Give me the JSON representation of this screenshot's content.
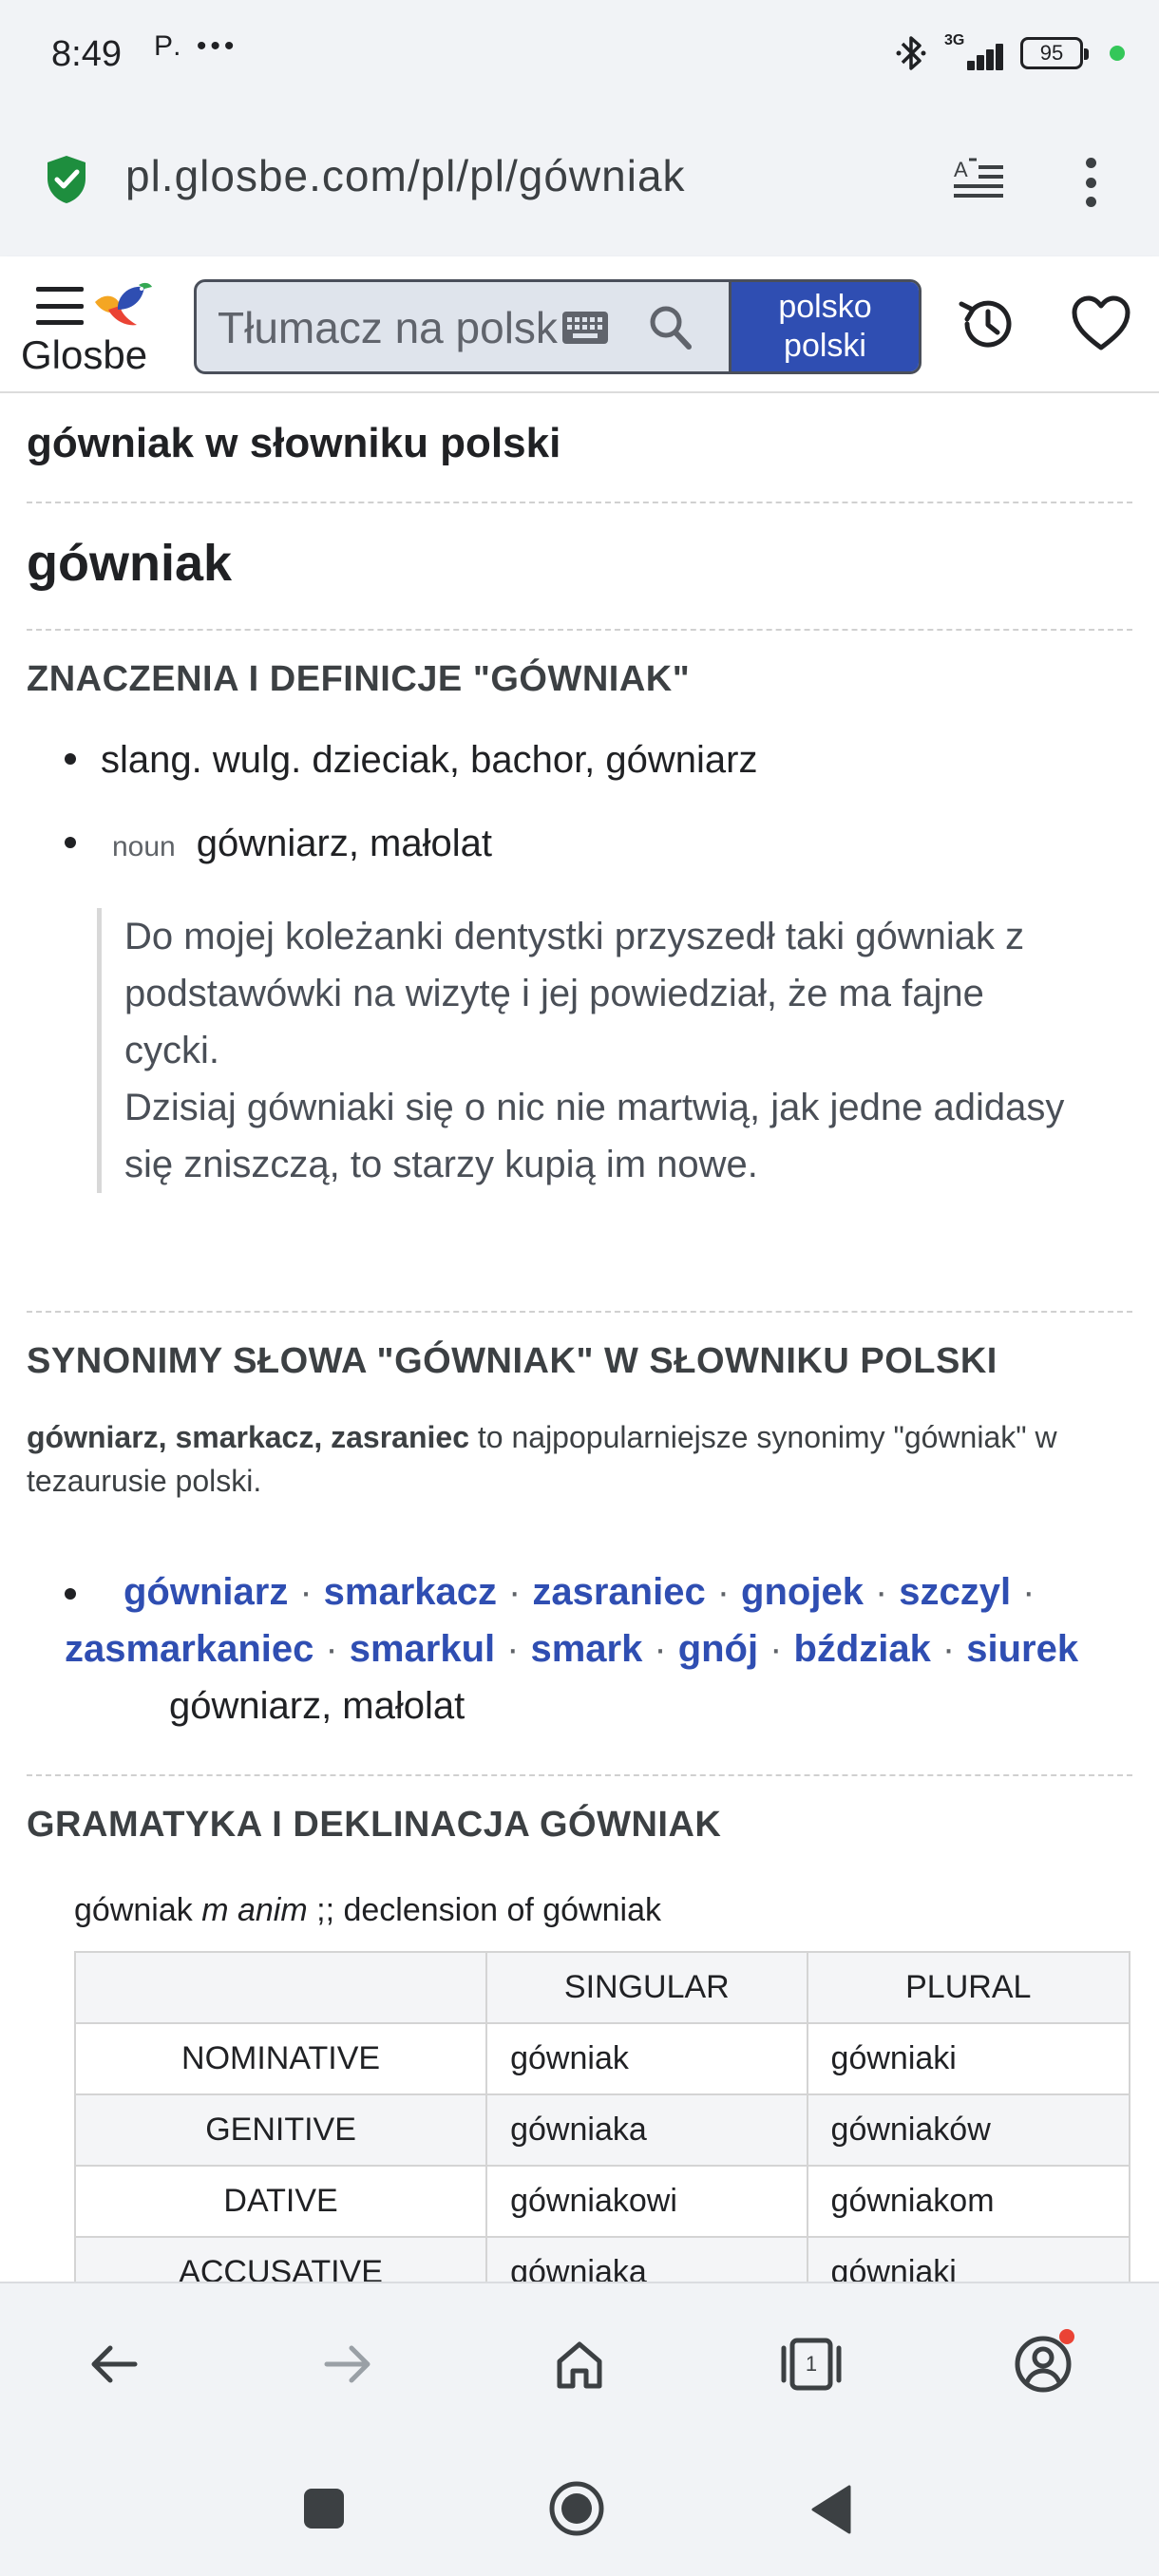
{
  "status_bar": {
    "time": "8:49",
    "extra": "P. •••",
    "network": "3G",
    "battery": "95"
  },
  "browser": {
    "url": "pl.glosbe.com/pl/pl/gówniak",
    "icons": [
      "shield-check-icon",
      "reader-mode-icon",
      "more-vert-icon"
    ]
  },
  "header": {
    "logo": "Glosbe",
    "search_placeholder": "Tłumacz na polski",
    "lang_line1": "polsko",
    "lang_line2": "polski",
    "icons": [
      "menu-icon",
      "glosbe-bird-icon",
      "keyboard-icon",
      "search-icon",
      "history-icon",
      "heart-icon"
    ]
  },
  "page": {
    "dictionary_title": "gówniak w słowniku polski",
    "headword": "gówniak",
    "meanings_heading": "ZNACZENIA I DEFINICJE \"GÓWNIAK\"",
    "meanings": [
      {
        "pos": "",
        "text": "slang. wulg. dzieciak, bachor, gówniarz"
      },
      {
        "pos": "noun",
        "text": "gówniarz, małolat"
      }
    ],
    "example_lines": [
      "Do mojej koleżanki dentystki przyszedł taki gówniak z",
      "podstawówki na wizytę i jej powiedział, że ma fajne",
      "cycki.",
      "Dzisiaj gówniaki się o nic nie martwią, jak jedne adidasy",
      "się zniszczą, to starzy kupią im nowe."
    ],
    "synonyms_heading": {
      "p1": "SYNONIMY ",
      "b1": "SŁOWA",
      "p2": " \"",
      "b2": "GÓWNIAK",
      "p3": "\" W SŁOWNIKU POLSKI"
    },
    "synonyms_desc": {
      "bold": "gówniarz, smarkacz, zasraniec",
      "rest": " to najpopularniejsze synonimy \"gówniak\" w tezaurusie polski."
    },
    "synonyms_line1": [
      "gówniarz",
      "smarkacz",
      "zasraniec",
      "gnojek",
      "szczyl"
    ],
    "synonyms_line2": [
      "zasmarkaniec",
      "smarkul",
      "smark",
      "gnój",
      "bździak",
      "siurek"
    ],
    "synonyms_gloss": "gówniarz, małolat",
    "separator": "·",
    "grammar_heading": "GRAMATYKA I DEKLINACJA GÓWNIAK",
    "decl_caption": {
      "word": "gówniak ",
      "gender": "m anim",
      "rest": " ;; declension of gówniak"
    },
    "decl_table": {
      "headers": [
        "",
        "SINGULAR",
        "PLURAL"
      ],
      "rows": [
        {
          "case": "NOMINATIVE",
          "singular": "gówniak",
          "plural": "gówniaki"
        },
        {
          "case": "GENITIVE",
          "singular": "gówniaka",
          "plural": "gówniaków"
        },
        {
          "case": "DATIVE",
          "singular": "gówniakowi",
          "plural": "gówniakom"
        },
        {
          "case": "ACCUSATIVE",
          "singular": "gówniaka",
          "plural": "gówniaki"
        }
      ]
    }
  },
  "bottom_bar": {
    "tabs_count": "1",
    "icons": [
      "back-arrow-icon",
      "forward-arrow-icon",
      "home-icon",
      "tabs-icon",
      "account-icon"
    ]
  },
  "colors": {
    "brand_blue": "#2f4eb2",
    "link_blue": "#2f4eb2",
    "chrome_bg": "#f1f3f6",
    "shield_green": "#1e8e3e"
  }
}
